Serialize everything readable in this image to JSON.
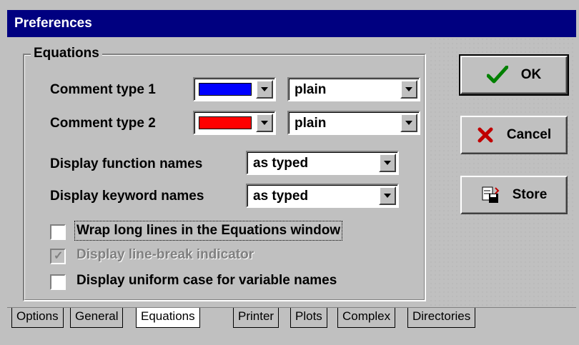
{
  "window": {
    "title": "Preferences"
  },
  "group": {
    "title": "Equations"
  },
  "fields": {
    "comment1": {
      "label": "Comment type 1",
      "color": "#0000ff",
      "style": "plain"
    },
    "comment2": {
      "label": "Comment type 2",
      "color": "#ff0000",
      "style": "plain"
    },
    "function_names": {
      "label": "Display function names",
      "value": "as typed"
    },
    "keyword_names": {
      "label": "Display keyword names",
      "value": "as typed"
    }
  },
  "checkboxes": [
    {
      "label": "Wrap long lines in the Equations window",
      "checked": false,
      "enabled": true
    },
    {
      "label": "Display line-break indicator",
      "checked": true,
      "enabled": false
    },
    {
      "label": "Display uniform case for variable names",
      "checked": false,
      "enabled": true
    }
  ],
  "buttons": {
    "ok": "OK",
    "cancel": "Cancel",
    "store": "Store"
  },
  "tabs": [
    "Options",
    "General",
    "Equations",
    "Printer",
    "Plots",
    "Complex",
    "Directories"
  ],
  "active_tab": "Equations"
}
